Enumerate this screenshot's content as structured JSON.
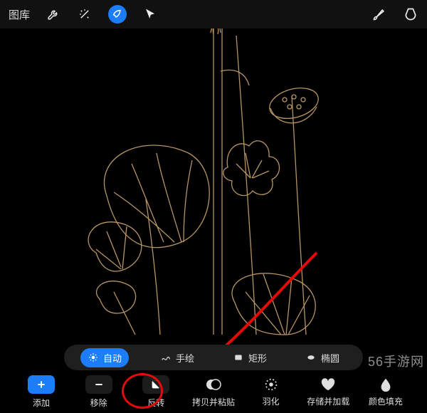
{
  "topbar": {
    "gallery_label": "图库",
    "wrench_icon": "wrench-icon",
    "wand_icon": "wand-icon",
    "select_icon": "select-icon",
    "cursor_icon": "cursor-icon",
    "brush_icon": "brush-icon",
    "smudge_icon": "smudge-icon"
  },
  "modes": {
    "auto": {
      "label": "自动",
      "active": true
    },
    "freehand": {
      "label": "手绘",
      "active": false
    },
    "rect": {
      "label": "矩形",
      "active": false
    },
    "ellipse": {
      "label": "椭圆",
      "active": false
    }
  },
  "actions": {
    "add": {
      "label": "添加"
    },
    "remove": {
      "label": "移除"
    },
    "invert": {
      "label": "反转"
    },
    "copy_paste": {
      "label": "拷贝并粘贴"
    },
    "feather": {
      "label": "羽化"
    },
    "save_load": {
      "label": "存储并加载"
    },
    "color_fill": {
      "label": "颜色填充"
    }
  },
  "watermark": "56手游网"
}
